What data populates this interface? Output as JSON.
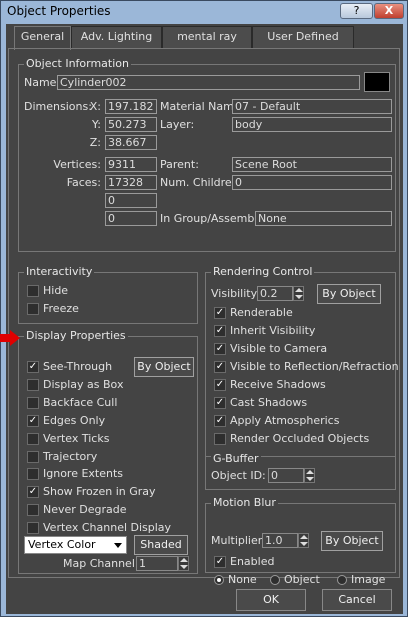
{
  "window": {
    "title": "Object Properties",
    "help_label": "?",
    "close_label": "X"
  },
  "tabs": [
    "General",
    "Adv. Lighting",
    "mental ray",
    "User Defined"
  ],
  "object_info": {
    "group_label": "Object Information",
    "name_label": "Name:",
    "name_value": "Cylinder002",
    "dimensions_label": "Dimensions:",
    "x_label": "X:",
    "x_value": "197.182",
    "y_label": "Y:",
    "y_value": "50.273",
    "z_label": "Z:",
    "z_value": "38.667",
    "vertices_label": "Vertices:",
    "vertices_value": "9311",
    "faces_label": "Faces:",
    "faces_value": "17328",
    "extra1_value": "0",
    "extra2_value": "0",
    "material_label": "Material Name:",
    "material_value": "07 - Default",
    "layer_label": "Layer:",
    "layer_value": "body",
    "parent_label": "Parent:",
    "parent_value": "Scene Root",
    "children_label": "Num. Children:",
    "children_value": "0",
    "group_assembly_label": "In Group/Assembly:",
    "group_assembly_value": "None",
    "color_swatch": "#000000"
  },
  "interactivity": {
    "group_label": "Interactivity",
    "items": [
      {
        "label": "Hide",
        "checked": false
      },
      {
        "label": "Freeze",
        "checked": false
      }
    ]
  },
  "display_properties": {
    "group_label": "Display Properties",
    "by_object_label": "By Object",
    "items": [
      {
        "label": "See-Through",
        "checked": true
      },
      {
        "label": "Display as Box",
        "checked": false
      },
      {
        "label": "Backface Cull",
        "checked": false
      },
      {
        "label": "Edges Only",
        "checked": true
      },
      {
        "label": "Vertex Ticks",
        "checked": false
      },
      {
        "label": "Trajectory",
        "checked": false
      },
      {
        "label": "Ignore Extents",
        "checked": false
      },
      {
        "label": "Show Frozen in Gray",
        "checked": true
      },
      {
        "label": "Never Degrade",
        "checked": false
      },
      {
        "label": "Vertex Channel Display",
        "checked": false
      }
    ],
    "vertex_color_value": "Vertex Color",
    "shaded_label": "Shaded",
    "map_channel_label": "Map Channel:",
    "map_channel_value": "1"
  },
  "rendering_control": {
    "group_label": "Rendering Control",
    "visibility_label": "Visibility:",
    "visibility_value": "0.2",
    "by_object_label": "By Object",
    "items": [
      {
        "label": "Renderable",
        "checked": true
      },
      {
        "label": "Inherit Visibility",
        "checked": true
      },
      {
        "label": "Visible to Camera",
        "checked": true
      },
      {
        "label": "Visible to Reflection/Refraction",
        "checked": true
      },
      {
        "label": "Receive Shadows",
        "checked": true
      },
      {
        "label": "Cast Shadows",
        "checked": true
      },
      {
        "label": "Apply Atmospherics",
        "checked": true
      },
      {
        "label": "Render Occluded Objects",
        "checked": false
      }
    ]
  },
  "gbuffer": {
    "group_label": "G-Buffer",
    "object_id_label": "Object ID:",
    "object_id_value": "0"
  },
  "motion_blur": {
    "group_label": "Motion Blur",
    "multiplier_label": "Multiplier:",
    "multiplier_value": "1.0",
    "by_object_label": "By Object",
    "enabled_label": "Enabled",
    "enabled_checked": true,
    "options": [
      "None",
      "Object",
      "Image"
    ],
    "selected": "None"
  },
  "footer": {
    "ok_label": "OK",
    "cancel_label": "Cancel"
  },
  "colors": {
    "panel_bg": "#444444",
    "titlebar_bg": "#9bb7d8",
    "close_bg": "#c04030",
    "pointer_arrow": "#e00000"
  }
}
